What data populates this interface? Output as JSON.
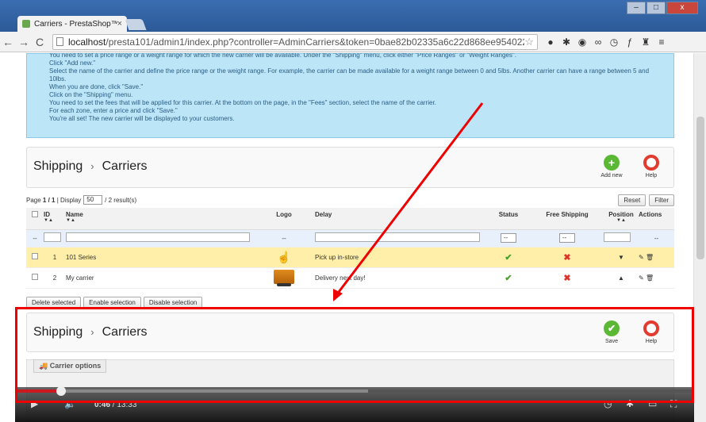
{
  "browser": {
    "tab_title": "Carriers - PrestaShop™",
    "tab_close": "×",
    "url_host": "localhost",
    "url_path": "/presta101/admin1/index.php?controller=AdminCarriers&token=0bae82b02335a6c22d868ee954022a11",
    "window_controls": [
      "–",
      "□",
      "x"
    ]
  },
  "help_text": [
    "You need to set a price range or a weight range for which the new carrier will be available. Under the \"Shipping\" menu, click either \"Price Ranges\" or \"Weight Ranges\".",
    "Click \"Add new.\"",
    "Select the name of the carrier and define the price range or the weight range. For example, the carrier can be made available for a weight range between 0 and 5lbs. Another carrier can have a range between 5 and 10lbs.",
    "When you are done, click \"Save.\"",
    "Click on the \"Shipping\" menu.",
    "You need to set the fees that will be applied for this carrier. At the bottom on the page, in the \"Fees\" section, select the name of the carrier.",
    "For each zone, enter a price and click \"Save.\"",
    "You're all set! The new carrier will be displayed to your customers."
  ],
  "list_panel": {
    "crumb_parent": "Shipping",
    "crumb_current": "Carriers",
    "crumb_sep": "›",
    "add_label": "Add new",
    "help_label": "Help"
  },
  "listbar": {
    "page_label": "Page",
    "page_value": "1 / 1",
    "display_label": "| Display",
    "per_page": "50",
    "results": "/ 2 result(s)",
    "reset": "Reset",
    "filter": "Filter"
  },
  "columns": {
    "id": "ID",
    "name": "Name",
    "logo": "Logo",
    "delay": "Delay",
    "status": "Status",
    "free_shipping": "Free Shipping",
    "position": "Position",
    "actions": "Actions"
  },
  "filter_row": {
    "dash": "--",
    "select_value": "--"
  },
  "rows": [
    {
      "id": "1",
      "name": "101 Series",
      "delay": "Pick up in-store",
      "status": "✔",
      "free": "✖",
      "position": "▼"
    },
    {
      "id": "2",
      "name": "My carrier",
      "delay": "Delivery next day!",
      "status": "✔",
      "free": "✖",
      "position": "▲"
    }
  ],
  "bulk": {
    "delete": "Delete selected",
    "enable": "Enable selection",
    "disable": "Disable selection"
  },
  "edit_panel": {
    "crumb_parent": "Shipping",
    "crumb_current": "Carriers",
    "crumb_sep": "›",
    "save_label": "Save",
    "help_label": "Help",
    "legend": "Carrier options"
  },
  "player": {
    "current_time": "0:46",
    "duration": "/ 13:33",
    "played_fraction": 0.068
  },
  "colors": {
    "annotation_red": "#e00000",
    "help_blue": "#bde5f8",
    "highlight_row": "#ffefa8"
  }
}
